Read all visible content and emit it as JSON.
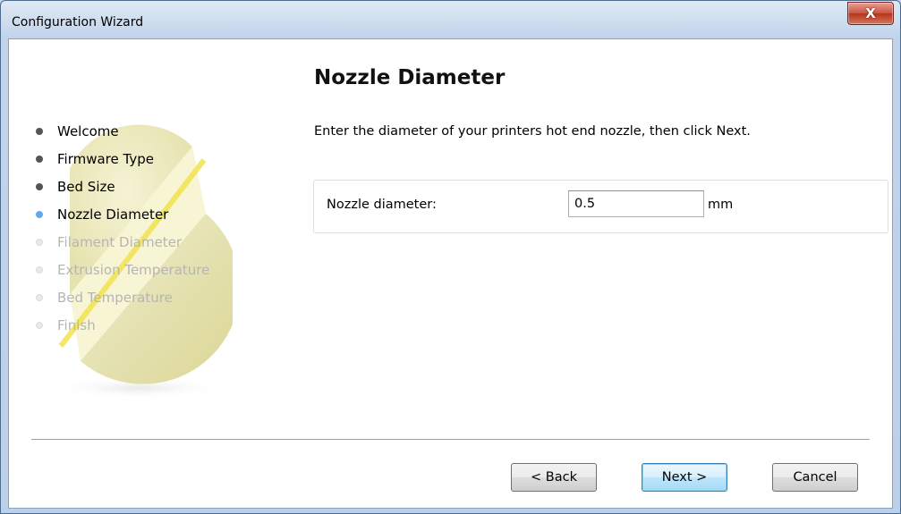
{
  "window": {
    "title": "Configuration Wizard",
    "close_glyph": "X"
  },
  "wizard": {
    "steps": [
      {
        "label": "Welcome",
        "state": "done"
      },
      {
        "label": "Firmware Type",
        "state": "done"
      },
      {
        "label": "Bed Size",
        "state": "done"
      },
      {
        "label": "Nozzle Diameter",
        "state": "current"
      },
      {
        "label": "Filament Diameter",
        "state": "future"
      },
      {
        "label": "Extrusion Temperature",
        "state": "future"
      },
      {
        "label": "Bed Temperature",
        "state": "future"
      },
      {
        "label": "Finish",
        "state": "future"
      }
    ]
  },
  "page": {
    "title": "Nozzle Diameter",
    "instructions": "Enter the diameter of your printers hot end nozzle, then click Next.",
    "field": {
      "label": "Nozzle diameter:",
      "value": "0.5",
      "unit": "mm"
    }
  },
  "buttons": {
    "back": "< Back",
    "next": "Next >",
    "cancel": "Cancel"
  },
  "icons": {
    "close": "close-icon",
    "logo": "slic3r-logo-icon"
  },
  "colors": {
    "current_step_dot": "#62a8ef",
    "done_step_dot": "#555555",
    "future_step_text": "#b5b5b5",
    "close_button": "#c9543f",
    "default_button_border": "#3c7fb1"
  }
}
